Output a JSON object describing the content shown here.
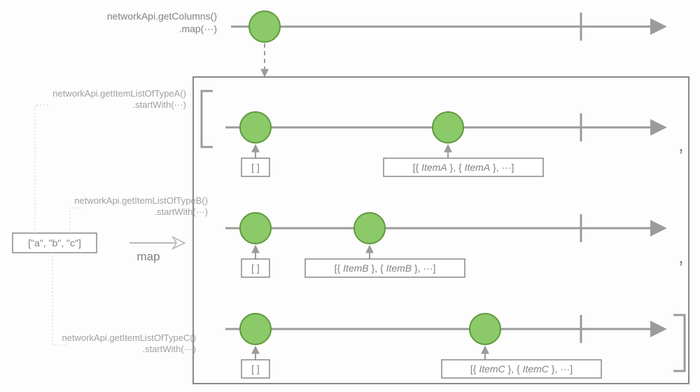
{
  "top": {
    "line1": "networkApi.getColumns()",
    "line2": ".map(···)"
  },
  "input_array": "[\"a\", \"b\", \"c\"]",
  "map_label": "map",
  "streamA": {
    "label1": "networkApi.getItemListOfTypeA()",
    "label2": ".startWith(···)",
    "b1": "[ ]",
    "b2": "[{ ItemA }, { ItemA }, ···]"
  },
  "streamB": {
    "label1": "networkApi.getItemListOfTypeB()",
    "label2": ".startWith(···)",
    "b1": "[ ]",
    "b2": "[{ ItemB }, { ItemB }, ···]"
  },
  "streamC": {
    "label1": "networkApi.getItemListOfTypeC()",
    "label2": ".startWith(···)",
    "b1": "[ ]",
    "b2": "[{ ItemC }, { ItemC }, ···]"
  },
  "comma": ",",
  "colors": {
    "marble": "#8cc969",
    "marbleStroke": "#5f9b3f",
    "stroke": "#9b9b9b",
    "light": "#c8c8c8",
    "lightest": "#dedede",
    "box": "#888888"
  }
}
